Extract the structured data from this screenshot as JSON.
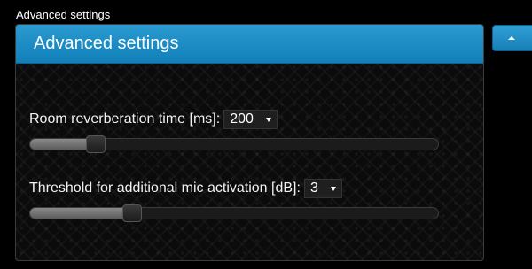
{
  "window": {
    "label": "Advanced settings"
  },
  "panel": {
    "title": "Advanced settings",
    "collapse_icon": "chevron-up-icon"
  },
  "settings": [
    {
      "label": "Room reverberation time [ms]:",
      "value": "200",
      "slider_fraction": 0.16
    },
    {
      "label": "Threshold for additional mic activation [dB]:",
      "value": "3",
      "slider_fraction": 0.25
    }
  ]
}
